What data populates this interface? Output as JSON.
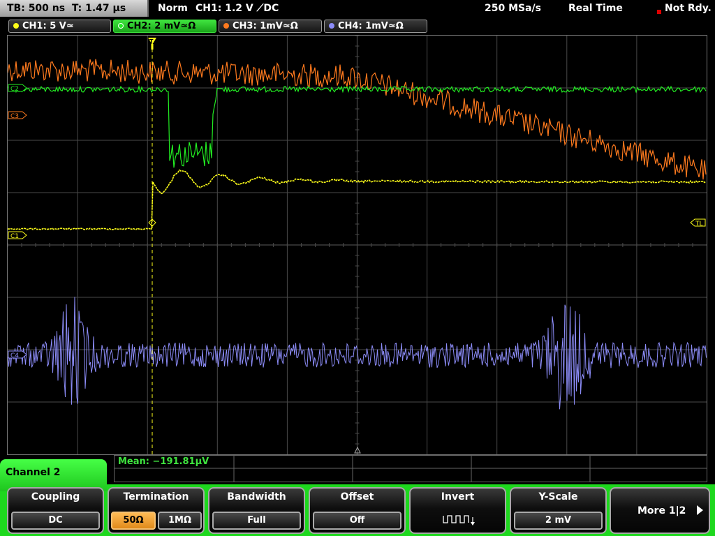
{
  "topbar": {
    "timebase": "TB: 500 ns",
    "trigger_time": "T: 1.47 µs",
    "trigger_mode": "Norm",
    "trigger_setting": "CH1: 1.2 V ⟋DC",
    "sample_rate": "250 MSa/s",
    "acq_mode": "Real Time",
    "status": "Not Rdy."
  },
  "channels": [
    {
      "label": "CH1: 5 V≃",
      "color": "#ffff1a"
    },
    {
      "label": "CH2: 2 mV≃Ω",
      "color": "#22ee22"
    },
    {
      "label": "CH3: 1mV≃Ω",
      "color": "#ff7a1e"
    },
    {
      "label": "CH4: 1mV≃Ω",
      "color": "#8c8cf8"
    }
  ],
  "markers": {
    "c3": "C3",
    "c2": "C2",
    "c1": "C1",
    "c4": "C4",
    "trigger_level": "TL",
    "trigger_position": "T"
  },
  "measurement": {
    "mean": "Mean: −191.81µV"
  },
  "side_tab": {
    "label": "Channel 2"
  },
  "softkeys": {
    "coupling": {
      "title": "Coupling",
      "value": "DC"
    },
    "termination": {
      "title": "Termination",
      "options": [
        "50Ω",
        "1MΩ"
      ],
      "selected": "50Ω"
    },
    "bandwidth": {
      "title": "Bandwidth",
      "value": "Full"
    },
    "offset": {
      "title": "Offset",
      "value": "Off"
    },
    "invert": {
      "title": "Invert",
      "icon": "invert-pulse-icon"
    },
    "yscale": {
      "title": "Y-Scale",
      "value": "2 mV"
    },
    "more": {
      "label": "More 1|2"
    }
  },
  "colors": {
    "ch1": "#ffff1a",
    "ch2": "#22ee22",
    "ch3": "#ff7a1e",
    "ch4": "#8c8cf8",
    "grid": "#4a4a4a"
  }
}
